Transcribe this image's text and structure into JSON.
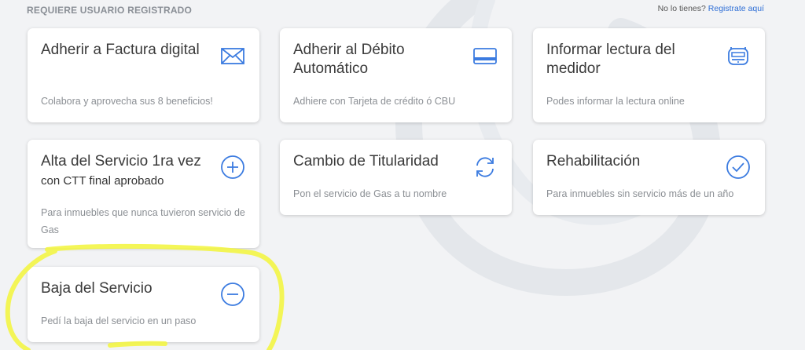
{
  "header": {
    "section_label": "REQUIERE USUARIO REGISTRADO",
    "register_prompt": "No lo tienes?",
    "register_link": "Registrate aquí"
  },
  "cards": [
    {
      "title": "Adherir a Factura digital",
      "subtitle": "",
      "description": "Colabora y aprovecha sus 8 beneficios!",
      "icon": "envelope-icon"
    },
    {
      "title": "Adherir al Débito Automático",
      "subtitle": "",
      "description": "Adhiere con Tarjeta de crédito ó CBU",
      "icon": "credit-card-icon"
    },
    {
      "title": "Informar lectura del medidor",
      "subtitle": "",
      "description": "Podes informar la lectura online",
      "icon": "gas-meter-icon"
    },
    {
      "title": "Alta del Servicio 1ra vez",
      "subtitle": "con CTT final aprobado",
      "description": "Para inmuebles que nunca tuvieron servicio de Gas",
      "icon": "plus-circle-icon"
    },
    {
      "title": "Cambio de Titularidad",
      "subtitle": "",
      "description": "Pon el servicio de Gas a tu nombre",
      "icon": "refresh-icon"
    },
    {
      "title": "Rehabilitación",
      "subtitle": "",
      "description": "Para inmuebles sin servicio más de un año",
      "icon": "check-circle-icon"
    },
    {
      "title": "Baja del Servicio",
      "subtitle": "",
      "description": "Pedí la baja del servicio en un paso",
      "icon": "minus-circle-icon"
    }
  ],
  "colors": {
    "accent": "#2f6fd6",
    "icon": "#3b7be0",
    "highlight": "#f3f545",
    "background": "#f2f3f5"
  }
}
